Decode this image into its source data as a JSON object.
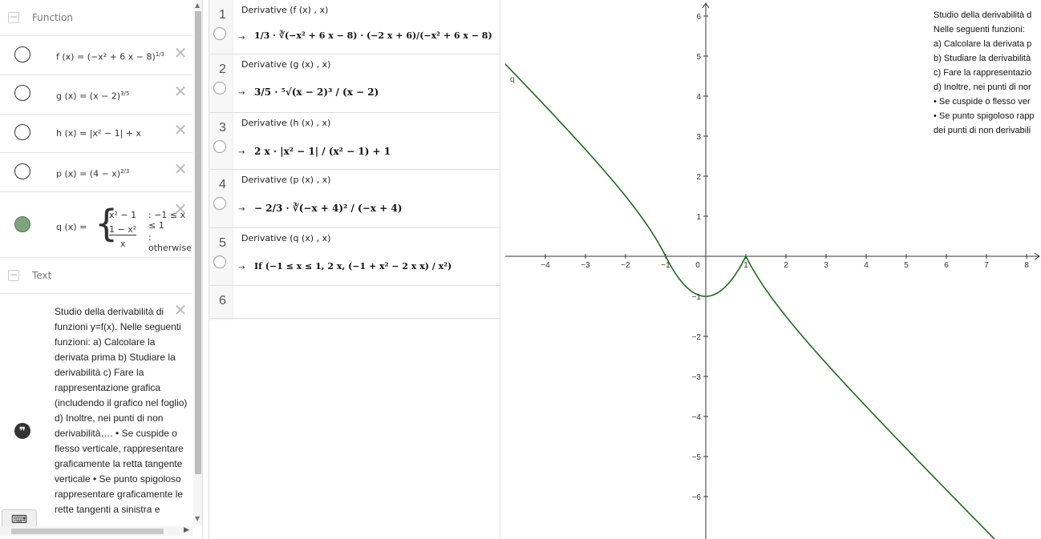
{
  "algebra": {
    "function_group": "Function",
    "text_group": "Text",
    "functions": {
      "f": "f (x) = (−x² + 6 x − 8)",
      "f_exp": "1/3",
      "g": "g (x) = (x − 2)",
      "g_exp": "3/5",
      "h": "h (x) = |x² − 1| + x",
      "p": "p (x) = (4 − x)",
      "p_exp": "2/3",
      "q_lhs": "q (x) =",
      "q_piece1": "x² − 1",
      "q_cond1": ": −1 ≤ x ≤ 1",
      "q_piece2_num": "1 − x²",
      "q_piece2_den": "x",
      "q_cond2": ": otherwise"
    },
    "text_body": "Studio della derivabilità di funzioni y=f(x). Nelle seguenti funzioni: a) Calcolare la derivata prima b) Studiare la derivabilità c) Fare la rappresentazione grafica (includendo il grafico nel foglio) d) Inoltre, nei punti di non derivabilità…. • Se cuspide o flesso verticale, rappresentare graficamente la retta tangente verticale • Se punto spigoloso rappresentare graficamente le rette tangenti a sinistra e",
    "keyboard_icon": "keyboard-icon"
  },
  "cas": {
    "rows": [
      {
        "num": "1",
        "input": "Derivative (f (x) , x)",
        "output": "1/3 · ∛(−x² + 6 x − 8) · (−2 x + 6)/(−x² + 6 x − 8)"
      },
      {
        "num": "2",
        "input": "Derivative (g (x) , x)",
        "output": "3/5 · ⁵√(x − 2)³ / (x − 2)"
      },
      {
        "num": "3",
        "input": "Derivative (h (x) , x)",
        "output": "2 x · |x² − 1| / (x² − 1) + 1"
      },
      {
        "num": "4",
        "input": "Derivative (p (x) , x)",
        "output": "− 2/3 · ∛(−x + 4)² / (−x + 4)"
      },
      {
        "num": "5",
        "input": "Derivative (q (x) , x)",
        "output": "If (−1 ≤ x ≤ 1, 2 x, (−1 + x² − 2 x x) / x²)"
      },
      {
        "num": "6",
        "input": "",
        "output": ""
      }
    ],
    "arrow": "→"
  },
  "graphics": {
    "curve_label": "q",
    "x_ticks": [
      "−4",
      "−3",
      "−2",
      "−1",
      "0",
      "1",
      "2",
      "3",
      "4",
      "5",
      "6",
      "7",
      "8"
    ],
    "y_ticks": [
      "6",
      "5",
      "4",
      "3",
      "2",
      "1",
      "−1",
      "−2",
      "−3",
      "−4",
      "−5",
      "−6"
    ],
    "side_text": [
      "Studio della derivabilità d",
      "Nelle seguenti funzioni:",
      "a) Calcolare la derivata p",
      "b) Studiare la derivabilità",
      "c) Fare la rappresentazio",
      "d) Inoltre, nei punti di nor",
      "• Se cuspide o flesso ver",
      "• Se punto spigoloso rapp",
      "dei punti di non derivabili"
    ],
    "curve_color": "#1e6b1e"
  }
}
